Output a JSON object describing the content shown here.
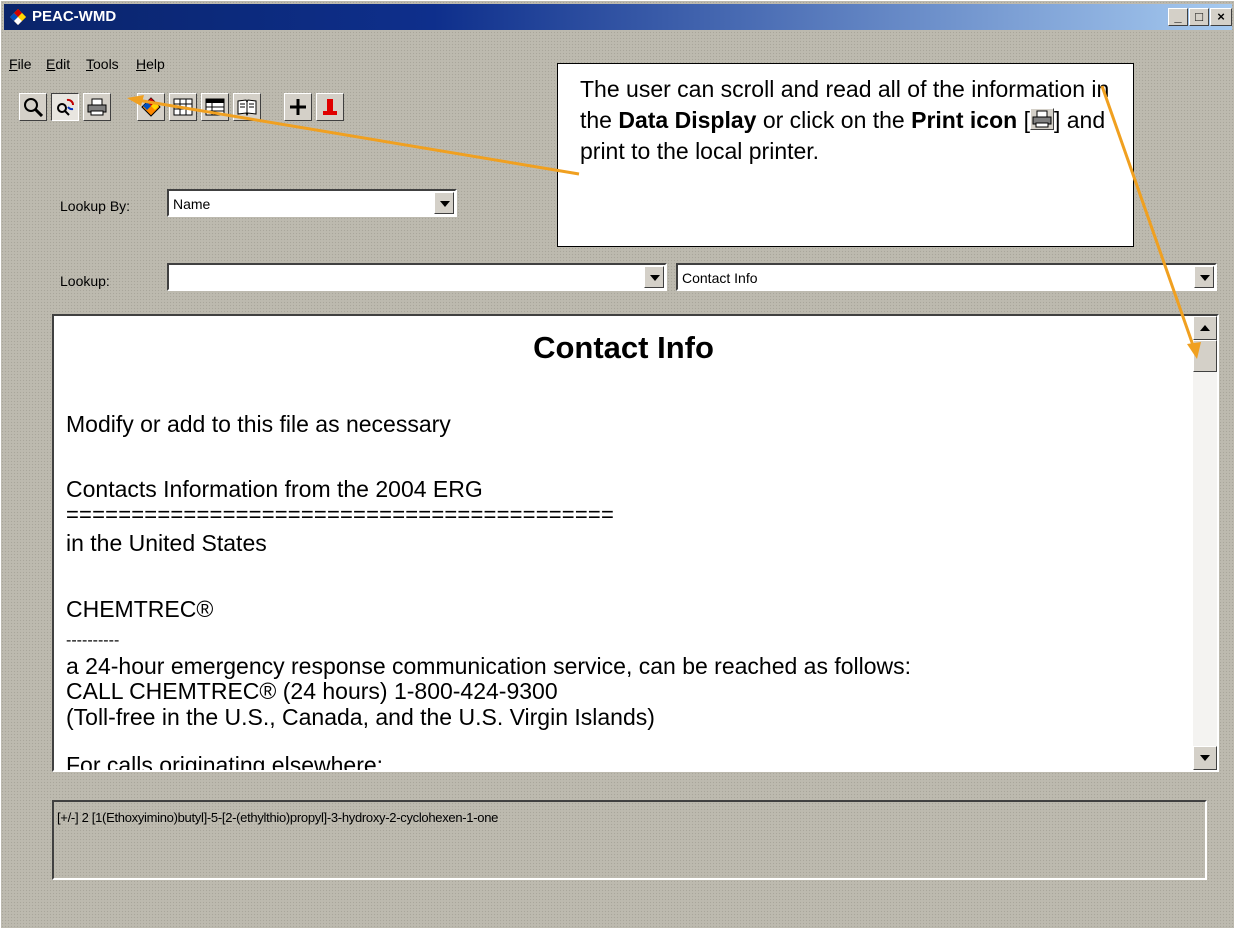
{
  "window": {
    "title": "PEAC-WMD",
    "minimize": "_",
    "maximize": "□",
    "close": "×"
  },
  "menu": [
    {
      "label": "File",
      "accel": "F",
      "rest": "ile"
    },
    {
      "label": "Edit",
      "accel": "E",
      "rest": "dit"
    },
    {
      "label": "Tools",
      "accel": "T",
      "rest": "ools"
    },
    {
      "label": "Help",
      "accel": "H",
      "rest": "elp"
    }
  ],
  "toolbar": {
    "icons": [
      "magnifier-icon",
      "search-refresh-icon",
      "printer-icon",
      "hazard-diamond-icon",
      "table-icon",
      "table-alt-icon",
      "book-icon",
      "plus-icon",
      "red-tool-icon"
    ]
  },
  "lookup_by": {
    "label": "Lookup By:",
    "value": "Name"
  },
  "lookup": {
    "label": "Lookup:",
    "value": "",
    "category": "Contact Info"
  },
  "display": {
    "title": "Contact Info",
    "lines": [
      "Modify or add to this file as necessary",
      "Contacts Information from the 2004 ERG",
      "==========================================",
      "in the United States",
      "CHEMTREC®",
      "----------",
      "a 24-hour emergency response communication service, can be reached as follows:",
      "CALL CHEMTREC® (24 hours) 1-800-424-9300",
      "(Toll-free in the U.S., Canada, and the U.S. Virgin Islands)",
      "For calls originating elsewhere:"
    ]
  },
  "status": {
    "text": "[+/-] 2 [1(Ethoxyimino)butyl]-5-[2-(ethylthio)propyl]-3-hydroxy-2-cyclohexen-1-one"
  },
  "callout": {
    "t1": "The user can scroll and read all of the information in the ",
    "b1": "Data Display",
    "t2": " or click on the ",
    "b2": "Print icon",
    "t3": " [",
    "t4": "] and print to the local printer."
  },
  "colors": {
    "arrow": "#f0a020",
    "titlebar": "#0a246a",
    "face": "#d4d0c8"
  }
}
